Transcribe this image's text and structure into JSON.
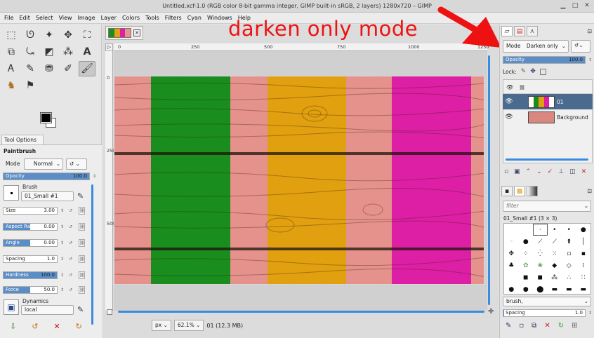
{
  "window": {
    "title": "Untitled.xcf-1.0 (RGB color 8-bit gamma integer, GIMP built-in sRGB, 2 layers) 1280x720 – GIMP",
    "controls": [
      "▁",
      "□",
      "✕"
    ]
  },
  "menu": [
    "File",
    "Edit",
    "Select",
    "View",
    "Image",
    "Layer",
    "Colors",
    "Tools",
    "Filters",
    "Cyan",
    "Windows",
    "Help"
  ],
  "annotation": {
    "text": "darken only mode",
    "color": "#ee1111"
  },
  "tools": [
    {
      "name": "rect-select-icon",
      "glyph": "⬚"
    },
    {
      "name": "lasso-icon",
      "glyph": "ᘎ"
    },
    {
      "name": "fuzzy-select-icon",
      "glyph": "✦"
    },
    {
      "name": "move-icon",
      "glyph": "✥"
    },
    {
      "name": "crop-icon",
      "glyph": "⛶"
    },
    {
      "name": "transform-icon",
      "glyph": "⧉"
    },
    {
      "name": "warp-icon",
      "glyph": "⤿"
    },
    {
      "name": "paint-bucket-icon",
      "glyph": "◩"
    },
    {
      "name": "clone-icon",
      "glyph": "⁂"
    },
    {
      "name": "text-icon",
      "glyph": "A"
    },
    {
      "name": "paths-icon",
      "glyph": "Ꭺ"
    },
    {
      "name": "pencil-icon",
      "glyph": "✎"
    },
    {
      "name": "stamp-icon",
      "glyph": "⛃"
    },
    {
      "name": "smudge-icon",
      "glyph": "✐"
    },
    {
      "name": "paintbrush-icon",
      "glyph": "🖌"
    },
    {
      "name": "mascot-icon",
      "glyph": "♞"
    },
    {
      "name": "color-picker-icon",
      "glyph": "⚑"
    }
  ],
  "colors": {
    "foreground": "#000000",
    "background": "#ffffff"
  },
  "tool_options": {
    "tab_label": "Tool Options",
    "tool_name": "Paintbrush",
    "mode_label": "Mode",
    "mode_value": "Normal",
    "opacity": {
      "label": "Opacity",
      "value": "100.0",
      "fill": 1.0
    },
    "brush_label": "Brush",
    "brush_name": "01_Small #1",
    "size": {
      "label": "Size",
      "value": "3.00"
    },
    "aspect_ratio": {
      "label": "Aspect Ratio",
      "value": "0.00"
    },
    "angle": {
      "label": "Angle",
      "value": "0.00"
    },
    "spacing": {
      "label": "Spacing",
      "value": "1.0"
    },
    "hardness": {
      "label": "Hardness",
      "value": "100.0",
      "fill": 1.0
    },
    "force": {
      "label": "Force",
      "value": "50.0",
      "fill": 0.5
    },
    "dynamics_label": "Dynamics",
    "dynamics_value": "local"
  },
  "canvas": {
    "ruler_h": [
      "0",
      "250",
      "500",
      "750",
      "1000",
      "1250"
    ],
    "ruler_v": [
      "0",
      "250",
      "500"
    ],
    "stripe_colors": [
      "#e5918c",
      "#1a8d1f",
      "#e5918c",
      "#e0a010",
      "#e5918c",
      "#dd1fa6",
      "#e5918c"
    ]
  },
  "status": {
    "unit": "px",
    "zoom": "62.1%",
    "layer_info": "01 (12.3 MB)"
  },
  "layers_dock": {
    "mode_label": "Mode",
    "mode_value": "Darken only",
    "opacity": {
      "label": "Opacity",
      "value": "100.0",
      "fill": 1.0
    },
    "lock_label": "Lock:",
    "layers": [
      {
        "name": "01",
        "selected": true
      },
      {
        "name": "Background",
        "selected": false
      }
    ]
  },
  "brushes_dock": {
    "filter_placeholder": "filter",
    "brush_title": "01_Small #1 (3 × 3)",
    "tag_value": "brush,",
    "spacing": {
      "label": "Spacing",
      "value": "1.0",
      "fill": 0.01
    }
  }
}
